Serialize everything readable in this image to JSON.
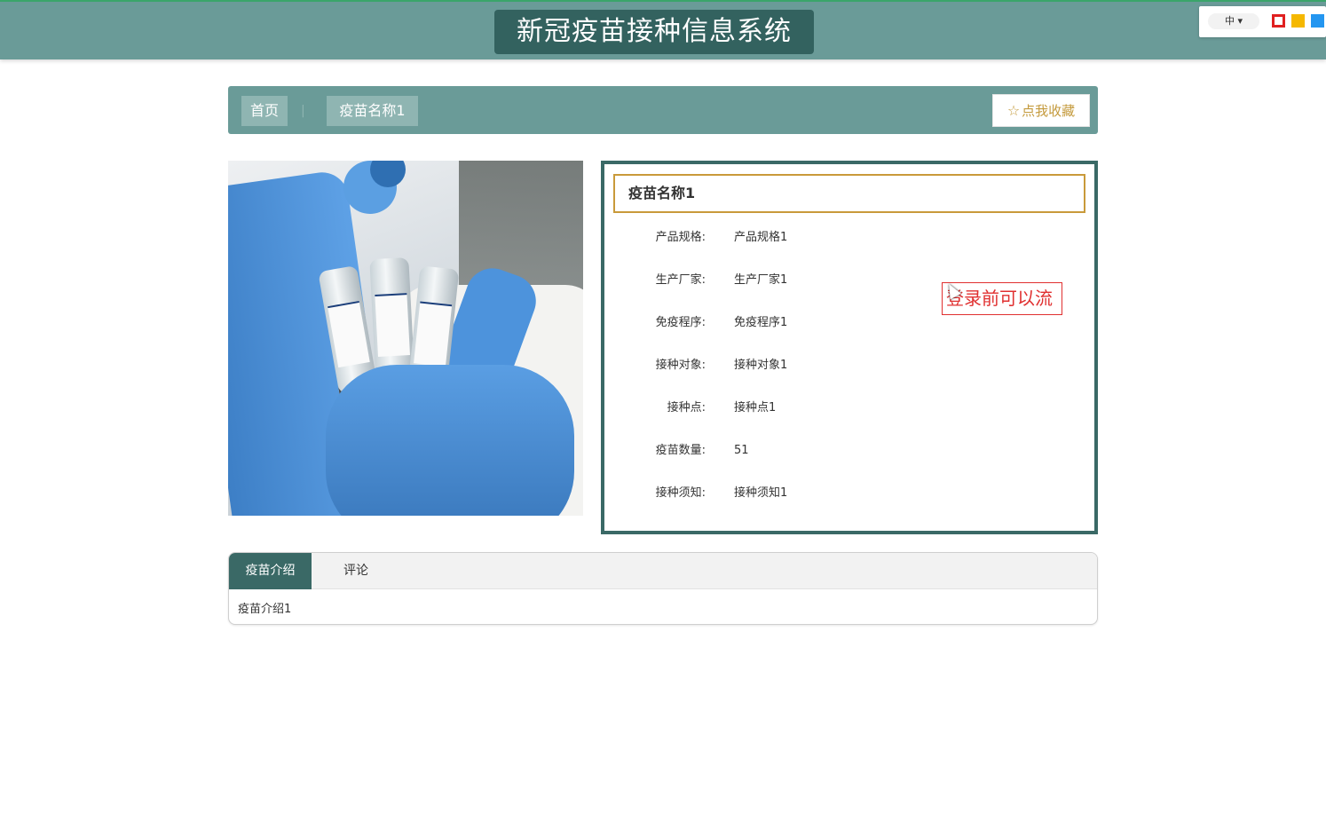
{
  "header": {
    "site_title": "新冠疫苗接种信息系统",
    "lang_label": "中 ▾",
    "colors": {
      "bar": "#6a9b98",
      "title_bg": "#33625f"
    }
  },
  "breadcrumb": {
    "home": "首页",
    "separator": "|",
    "current": "疫苗名称1",
    "favorite_icon": "star-outline-icon",
    "favorite_label": "点我收藏"
  },
  "product": {
    "image_alt": "vaccine-vials-photo",
    "name": "疫苗名称1",
    "fields": [
      {
        "key": "产品规格:",
        "value": "产品规格1"
      },
      {
        "key": "生产厂家:",
        "value": "生产厂家1"
      },
      {
        "key": "免疫程序:",
        "value": "免疫程序1"
      },
      {
        "key": "接种对象:",
        "value": "接种对象1"
      },
      {
        "key": "接种点:",
        "value": "接种点1"
      },
      {
        "key": "疫苗数量:",
        "value": "51"
      },
      {
        "key": "接种须知:",
        "value": "接种须知1"
      }
    ],
    "notice": "登录前可以流"
  },
  "tabs": {
    "items": [
      "疫苗介绍",
      "评论"
    ],
    "active": 0,
    "content": "疫苗介绍1"
  }
}
